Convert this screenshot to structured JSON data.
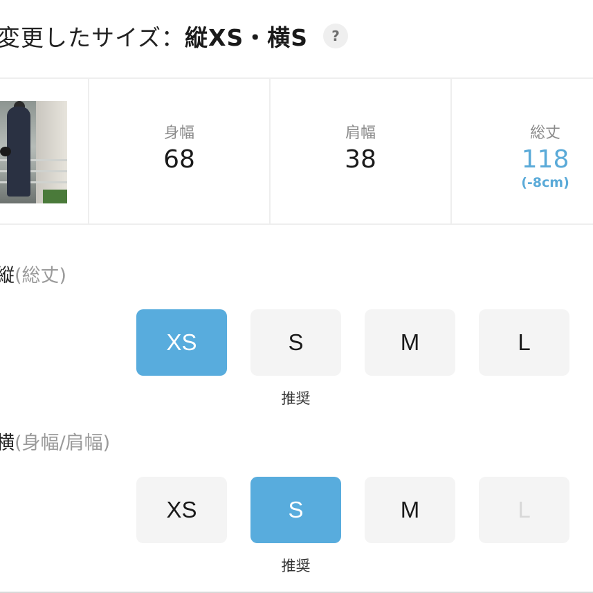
{
  "header": {
    "prefix": "変更したサイズ：",
    "value": "縦XS・横S",
    "help_icon": "question-icon",
    "help_glyph": "?"
  },
  "measurements": [
    {
      "label": "身幅",
      "value": "68",
      "diff": ""
    },
    {
      "label": "肩幅",
      "value": "38",
      "diff": ""
    },
    {
      "label": "総丈",
      "value": "118",
      "diff": "(-8cm)"
    }
  ],
  "colors": {
    "accent": "#58acdd",
    "changed_text": "#5aaad8",
    "button_bg": "#f4f4f4"
  },
  "vertical": {
    "label": "縦",
    "sub": "(総丈)",
    "sizes": [
      "XS",
      "S",
      "M",
      "L"
    ],
    "selected": "XS",
    "recommended": "S",
    "recommended_label": "推奨"
  },
  "horizontal": {
    "label": "横",
    "sub": "(身幅/肩幅)",
    "sizes": [
      "XS",
      "S",
      "M",
      "L"
    ],
    "selected": "S",
    "disabled": [
      "L"
    ],
    "recommended": "S",
    "recommended_label": "推奨"
  }
}
